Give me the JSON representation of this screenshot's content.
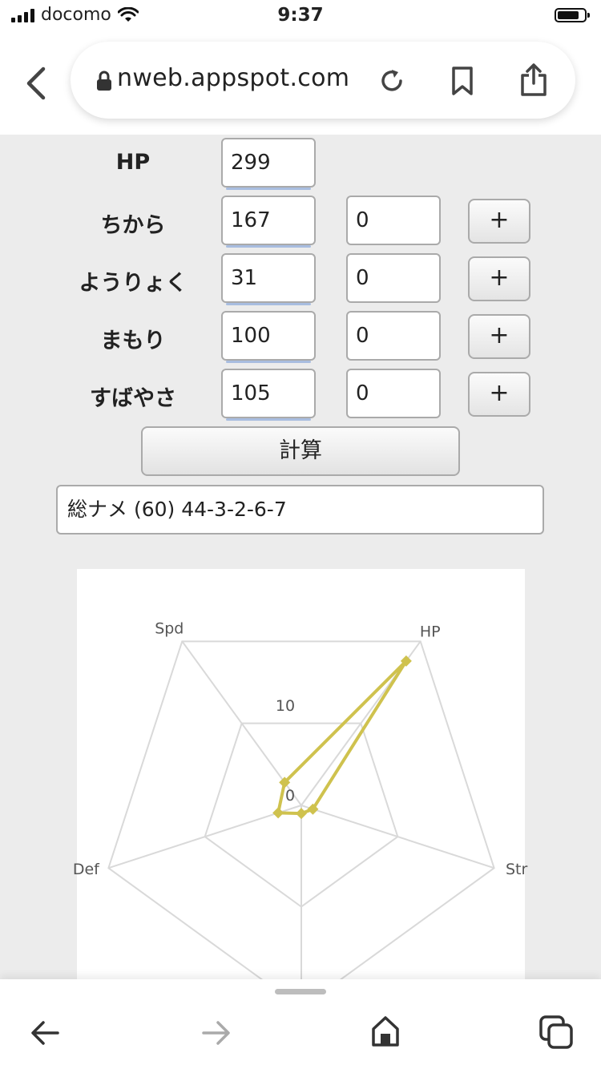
{
  "status_bar": {
    "carrier": "docomo",
    "time": "9:37"
  },
  "browser": {
    "url": "nweb.appspot.com"
  },
  "form": {
    "hp": {
      "label": "HP",
      "value": "299"
    },
    "rows": [
      {
        "label": "ちから",
        "value": "167",
        "ev": "0",
        "plus": "+"
      },
      {
        "label": "ようりょく",
        "value": "31",
        "ev": "0",
        "plus": "+"
      },
      {
        "label": "まもり",
        "value": "100",
        "ev": "0",
        "plus": "+"
      },
      {
        "label": "すばやさ",
        "value": "105",
        "ev": "0",
        "plus": "+"
      }
    ],
    "calculate_label": "計算",
    "result": "総ナメ (60) 44-3-2-6-7"
  },
  "chart_data": {
    "type": "radar",
    "axes": [
      "HP",
      "Str",
      "",
      "Def",
      "Spd"
    ],
    "values": [
      44,
      3,
      2,
      6,
      7
    ],
    "tick_labels": [
      "0",
      "10"
    ],
    "series_color": "#cfc24e",
    "grid_color": "#d9d9d9",
    "grid": true
  }
}
